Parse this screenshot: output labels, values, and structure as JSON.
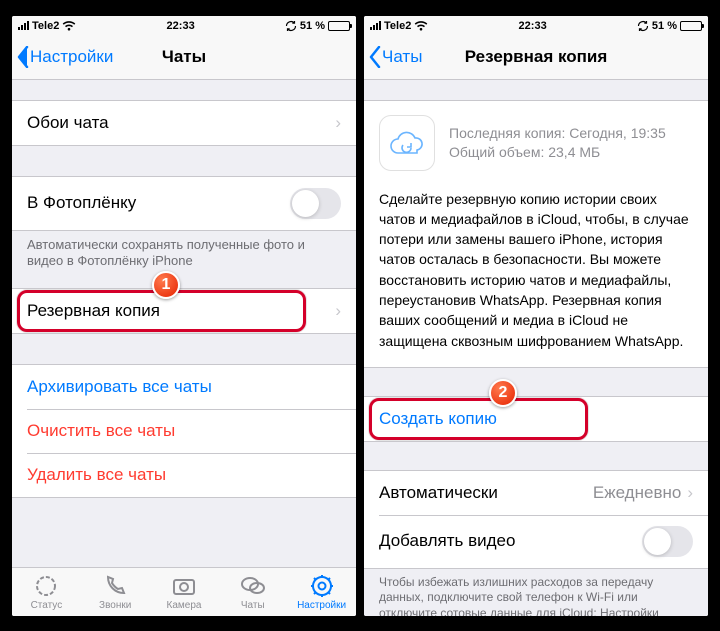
{
  "statusbar": {
    "carrier": "Tele2",
    "time": "22:33",
    "battery_pct": "51 %"
  },
  "left": {
    "back": "Настройки",
    "title": "Чаты",
    "wallpaper": "Обои чата",
    "cameraroll": "В Фотоплёнку",
    "cameraroll_footer": "Автоматически сохранять полученные фото и видео в Фотоплёнку iPhone",
    "backup": "Резервная копия",
    "archive": "Архивировать все чаты",
    "clear": "Очистить все чаты",
    "delete": "Удалить все чаты",
    "tabs": {
      "status": "Статус",
      "calls": "Звонки",
      "camera": "Камера",
      "chats": "Чаты",
      "settings": "Настройки"
    },
    "badge": "1"
  },
  "right": {
    "back": "Чаты",
    "title": "Резервная копия",
    "last_label": "Последняя копия: Сегодня, 19:35",
    "size_label": "Общий объем: 23,4 МБ",
    "description": "Сделайте резервную копию истории своих чатов и медиафайлов в iCloud, чтобы, в случае потери или замены вашего iPhone, история чатов осталась в безопасности. Вы можете восстановить историю чатов и медиафайлы, переустановив WhatsApp. Резервная копия ваших сообщений и медиа в iCloud не защищена сквозным шифрованием WhatsApp.",
    "create": "Создать копию",
    "auto": "Автоматически",
    "auto_val": "Ежедневно",
    "video": "Добавлять видео",
    "footer": "Чтобы избежать излишних расходов за передачу данных, подключите свой телефон к Wi-Fi или отключите сотовые данные для iCloud: Настройки iPhone > Сотовая связь > iCloud Drive > Выкл.",
    "badge": "2"
  }
}
